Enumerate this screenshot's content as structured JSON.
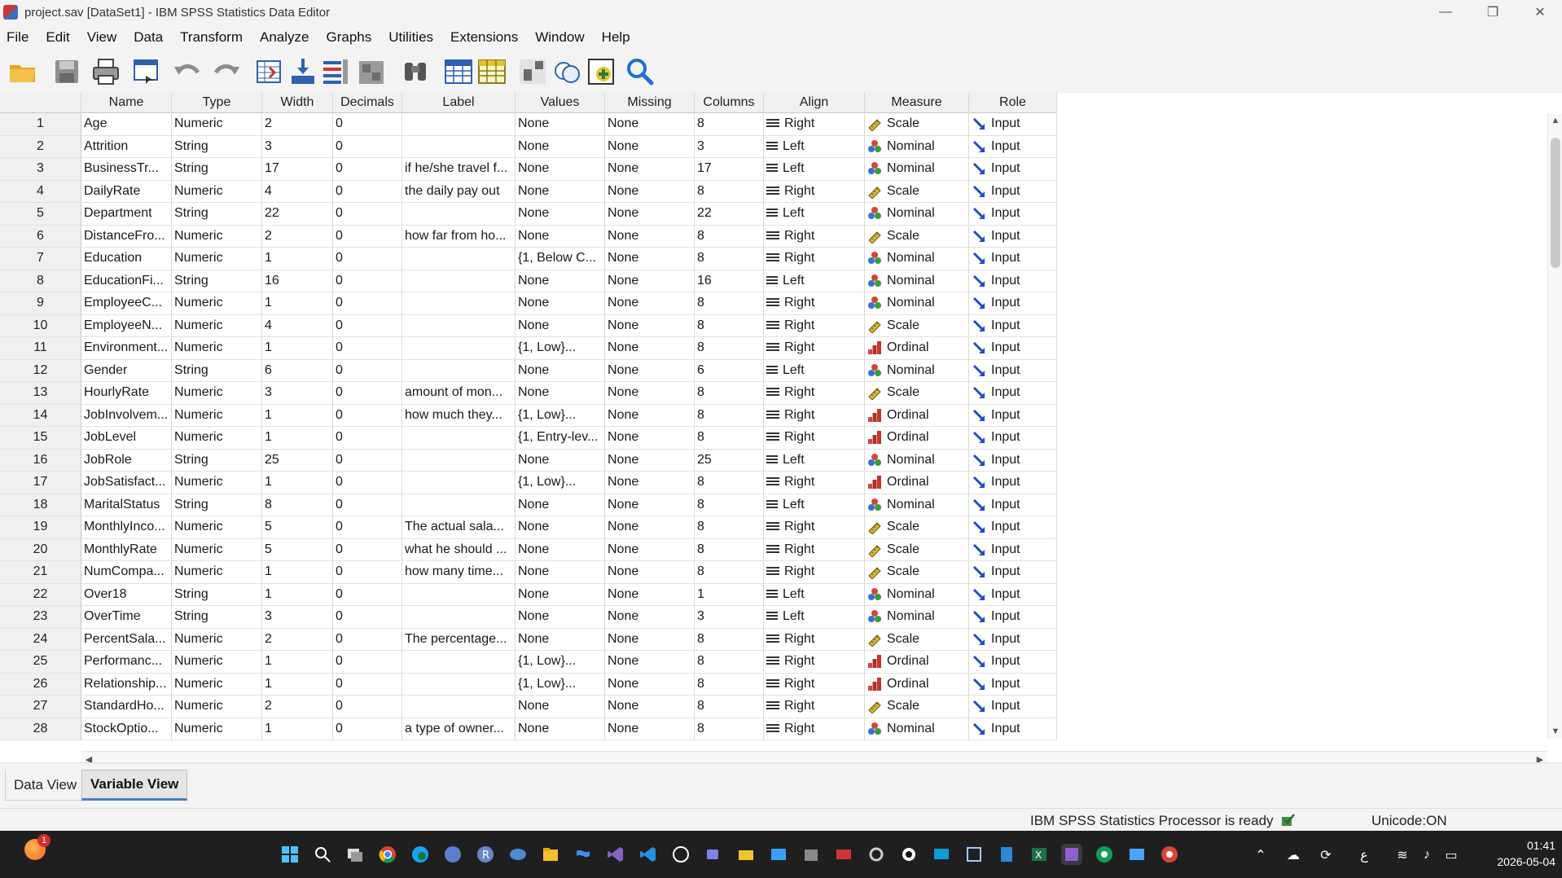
{
  "window": {
    "title": "project.sav [DataSet1] - IBM SPSS Statistics Data Editor",
    "minimize": "—",
    "restore": "❐",
    "close": "✕"
  },
  "menu": [
    "File",
    "Edit",
    "View",
    "Data",
    "Transform",
    "Analyze",
    "Graphs",
    "Utilities",
    "Extensions",
    "Window",
    "Help"
  ],
  "toolbar": [
    "open-folder-icon",
    "save-icon",
    "print-icon",
    "recall-dialog-icon",
    "undo-icon",
    "redo-icon",
    "goto-case-icon",
    "goto-variable-icon",
    "variables-icon",
    "run-descriptives-icon",
    "find-icon",
    "insert-cases-icon",
    "insert-variable-icon",
    "split-file-icon",
    "value-labels-icon",
    "use-sets-icon",
    "search-icon"
  ],
  "columns": [
    "Name",
    "Type",
    "Width",
    "Decimals",
    "Label",
    "Values",
    "Missing",
    "Columns",
    "Align",
    "Measure",
    "Role"
  ],
  "rows": [
    [
      "1",
      "Age",
      "Numeric",
      "2",
      "0",
      "",
      "None",
      "None",
      "8",
      "Right",
      "Scale",
      "Input"
    ],
    [
      "2",
      "Attrition",
      "String",
      "3",
      "0",
      "",
      "None",
      "None",
      "3",
      "Left",
      "Nominal",
      "Input"
    ],
    [
      "3",
      "BusinessTr...",
      "String",
      "17",
      "0",
      "if he/she travel f...",
      "None",
      "None",
      "17",
      "Left",
      "Nominal",
      "Input"
    ],
    [
      "4",
      "DailyRate",
      "Numeric",
      "4",
      "0",
      "the daily pay out",
      "None",
      "None",
      "8",
      "Right",
      "Scale",
      "Input"
    ],
    [
      "5",
      "Department",
      "String",
      "22",
      "0",
      "",
      "None",
      "None",
      "22",
      "Left",
      "Nominal",
      "Input"
    ],
    [
      "6",
      "DistanceFro...",
      "Numeric",
      "2",
      "0",
      "how far from ho...",
      "None",
      "None",
      "8",
      "Right",
      "Scale",
      "Input"
    ],
    [
      "7",
      "Education",
      "Numeric",
      "1",
      "0",
      "",
      "{1, Below C...",
      "None",
      "8",
      "Right",
      "Nominal",
      "Input"
    ],
    [
      "8",
      "EducationFi...",
      "String",
      "16",
      "0",
      "",
      "None",
      "None",
      "16",
      "Left",
      "Nominal",
      "Input"
    ],
    [
      "9",
      "EmployeeC...",
      "Numeric",
      "1",
      "0",
      "",
      "None",
      "None",
      "8",
      "Right",
      "Nominal",
      "Input"
    ],
    [
      "10",
      "EmployeeN...",
      "Numeric",
      "4",
      "0",
      "",
      "None",
      "None",
      "8",
      "Right",
      "Scale",
      "Input"
    ],
    [
      "11",
      "Environment...",
      "Numeric",
      "1",
      "0",
      "",
      "{1, Low}...",
      "None",
      "8",
      "Right",
      "Ordinal",
      "Input"
    ],
    [
      "12",
      "Gender",
      "String",
      "6",
      "0",
      "",
      "None",
      "None",
      "6",
      "Left",
      "Nominal",
      "Input"
    ],
    [
      "13",
      "HourlyRate",
      "Numeric",
      "3",
      "0",
      "amount of mon...",
      "None",
      "None",
      "8",
      "Right",
      "Scale",
      "Input"
    ],
    [
      "14",
      "JobInvolvem...",
      "Numeric",
      "1",
      "0",
      "how much they...",
      "{1, Low}...",
      "None",
      "8",
      "Right",
      "Ordinal",
      "Input"
    ],
    [
      "15",
      "JobLevel",
      "Numeric",
      "1",
      "0",
      "",
      "{1, Entry-lev...",
      "None",
      "8",
      "Right",
      "Ordinal",
      "Input"
    ],
    [
      "16",
      "JobRole",
      "String",
      "25",
      "0",
      "",
      "None",
      "None",
      "25",
      "Left",
      "Nominal",
      "Input"
    ],
    [
      "17",
      "JobSatisfact...",
      "Numeric",
      "1",
      "0",
      "",
      "{1, Low}...",
      "None",
      "8",
      "Right",
      "Ordinal",
      "Input"
    ],
    [
      "18",
      "MaritalStatus",
      "String",
      "8",
      "0",
      "",
      "None",
      "None",
      "8",
      "Left",
      "Nominal",
      "Input"
    ],
    [
      "19",
      "MonthlyInco...",
      "Numeric",
      "5",
      "0",
      "The actual sala...",
      "None",
      "None",
      "8",
      "Right",
      "Scale",
      "Input"
    ],
    [
      "20",
      "MonthlyRate",
      "Numeric",
      "5",
      "0",
      "what he should ...",
      "None",
      "None",
      "8",
      "Right",
      "Scale",
      "Input"
    ],
    [
      "21",
      "NumCompa...",
      "Numeric",
      "1",
      "0",
      "how many time...",
      "None",
      "None",
      "8",
      "Right",
      "Scale",
      "Input"
    ],
    [
      "22",
      "Over18",
      "String",
      "1",
      "0",
      "",
      "None",
      "None",
      "1",
      "Left",
      "Nominal",
      "Input"
    ],
    [
      "23",
      "OverTime",
      "String",
      "3",
      "0",
      "",
      "None",
      "None",
      "3",
      "Left",
      "Nominal",
      "Input"
    ],
    [
      "24",
      "PercentSala...",
      "Numeric",
      "2",
      "0",
      "The percentage...",
      "None",
      "None",
      "8",
      "Right",
      "Scale",
      "Input"
    ],
    [
      "25",
      "Performanc...",
      "Numeric",
      "1",
      "0",
      "",
      "{1, Low}...",
      "None",
      "8",
      "Right",
      "Ordinal",
      "Input"
    ],
    [
      "26",
      "Relationship...",
      "Numeric",
      "1",
      "0",
      "",
      "{1, Low}...",
      "None",
      "8",
      "Right",
      "Ordinal",
      "Input"
    ],
    [
      "27",
      "StandardHo...",
      "Numeric",
      "2",
      "0",
      "",
      "None",
      "None",
      "8",
      "Right",
      "Scale",
      "Input"
    ],
    [
      "28",
      "StockOptio...",
      "Numeric",
      "1",
      "0",
      "a type of owner...",
      "None",
      "None",
      "8",
      "Right",
      "Nominal",
      "Input"
    ]
  ],
  "tabs": {
    "data_view": "Data View",
    "variable_view": "Variable View"
  },
  "status": {
    "processor": "IBM SPSS Statistics Processor is ready",
    "unicode": "Unicode:ON"
  },
  "taskbar": {
    "time": "01:41",
    "date": "2026-05-04",
    "notification_count": "1",
    "lang": "ع"
  },
  "colors": {
    "accent": "#4a7fc1",
    "scale": "#c9a227",
    "nominal_red": "#d8443a",
    "nominal_blue": "#3b6fd6",
    "nominal_green": "#3a9a3a",
    "ordinal": "#c0392b",
    "input": "#1f4fbf"
  }
}
